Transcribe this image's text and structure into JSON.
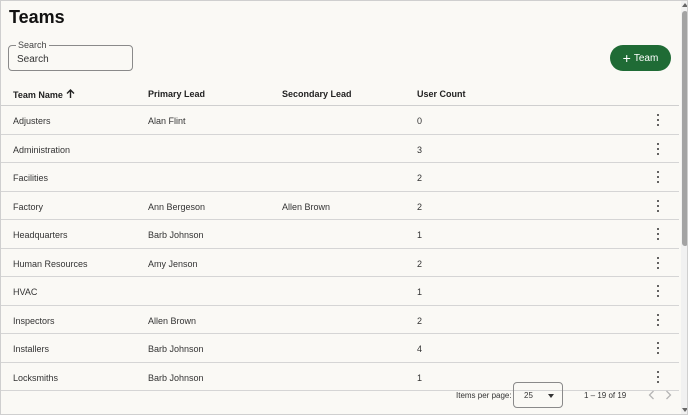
{
  "page": {
    "title": "Teams"
  },
  "search": {
    "label": "Search",
    "placeholder": "Search",
    "value": ""
  },
  "actions": {
    "add_team_label": "Team",
    "add_team_icon": "plus-icon",
    "accent_color": "#1f6b35"
  },
  "table": {
    "columns": [
      {
        "label": "Team Name",
        "sort": "ascending"
      },
      {
        "label": "Primary Lead"
      },
      {
        "label": "Secondary Lead"
      },
      {
        "label": "User Count"
      }
    ],
    "rows": [
      {
        "team": "Adjusters",
        "primary": "Alan Flint",
        "secondary": "",
        "count": "0"
      },
      {
        "team": "Administration",
        "primary": "",
        "secondary": "",
        "count": "3"
      },
      {
        "team": "Facilities",
        "primary": "",
        "secondary": "",
        "count": "2"
      },
      {
        "team": "Factory",
        "primary": "Ann Bergeson",
        "secondary": "Allen Brown",
        "count": "2"
      },
      {
        "team": "Headquarters",
        "primary": "Barb Johnson",
        "secondary": "",
        "count": "1"
      },
      {
        "team": "Human Resources",
        "primary": "Amy Jenson",
        "secondary": "",
        "count": "2"
      },
      {
        "team": "HVAC",
        "primary": "",
        "secondary": "",
        "count": "1"
      },
      {
        "team": "Inspectors",
        "primary": "Allen Brown",
        "secondary": "",
        "count": "2"
      },
      {
        "team": "Installers",
        "primary": "Barb Johnson",
        "secondary": "",
        "count": "4"
      },
      {
        "team": "Locksmiths",
        "primary": "Barb Johnson",
        "secondary": "",
        "count": "1"
      }
    ]
  },
  "pagination": {
    "items_per_page_label": "Items per page:",
    "items_per_page": "25",
    "range": "1 – 19 of 19"
  }
}
